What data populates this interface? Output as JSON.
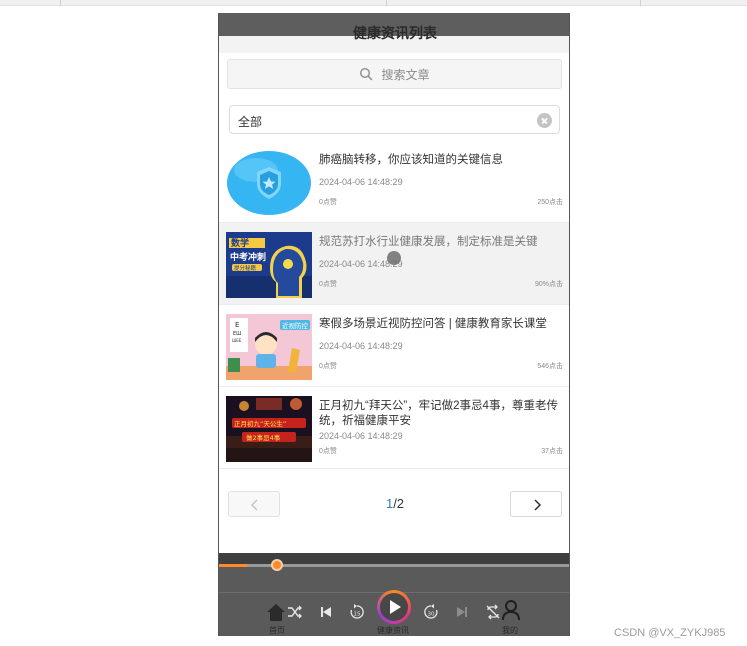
{
  "header": {
    "title": "健康资讯列表"
  },
  "search": {
    "placeholder": "搜索文章"
  },
  "filter": {
    "value": "全部"
  },
  "articles": [
    {
      "title": "肺癌脑转移，你应该知道的关键信息",
      "time": "2024-04-06 14:48:29",
      "likes": "0点赞",
      "clicks": "250点击",
      "thumb": "shield-badge"
    },
    {
      "title": "规范苏打水行业健康发展，制定标准是关键",
      "time": "2024-04-06 14:48:29",
      "likes": "0点赞",
      "clicks": "90%点击",
      "thumb": "brain-poster",
      "thumb_text": [
        "数学",
        "中考冲刺",
        "提分秘籍"
      ]
    },
    {
      "title": "寒假多场景近视防控问答 | 健康教育家长课堂",
      "time": "2024-04-06 14:48:29",
      "likes": "0点赞",
      "clicks": "546点击",
      "thumb": "eye-chart-kid",
      "thumb_text": [
        "近视防控"
      ]
    },
    {
      "title": "正月初九“拜天公”，牢记做2事忌4事，尊重老传统，祈福健康平安",
      "time": "2024-04-06 14:48:29",
      "likes": "0点赞",
      "clicks": "37点击",
      "thumb": "temple-night",
      "thumb_text": [
        "正月初九“天公生”",
        "做2事忌4事"
      ]
    }
  ],
  "pagination": {
    "current": "1",
    "total": "/2"
  },
  "player": {
    "progress": 0.08
  },
  "tabs": [
    {
      "label": "首页"
    },
    {
      "label": "健康资讯"
    },
    {
      "label": "我的"
    }
  ],
  "watermark": "CSDN @VX_ZYKJ985",
  "colors": {
    "accent": "#ff8a2b",
    "link": "#2a7ab8",
    "header_bg": "#5e5e5e",
    "player_bg": "#5a5a5a"
  }
}
